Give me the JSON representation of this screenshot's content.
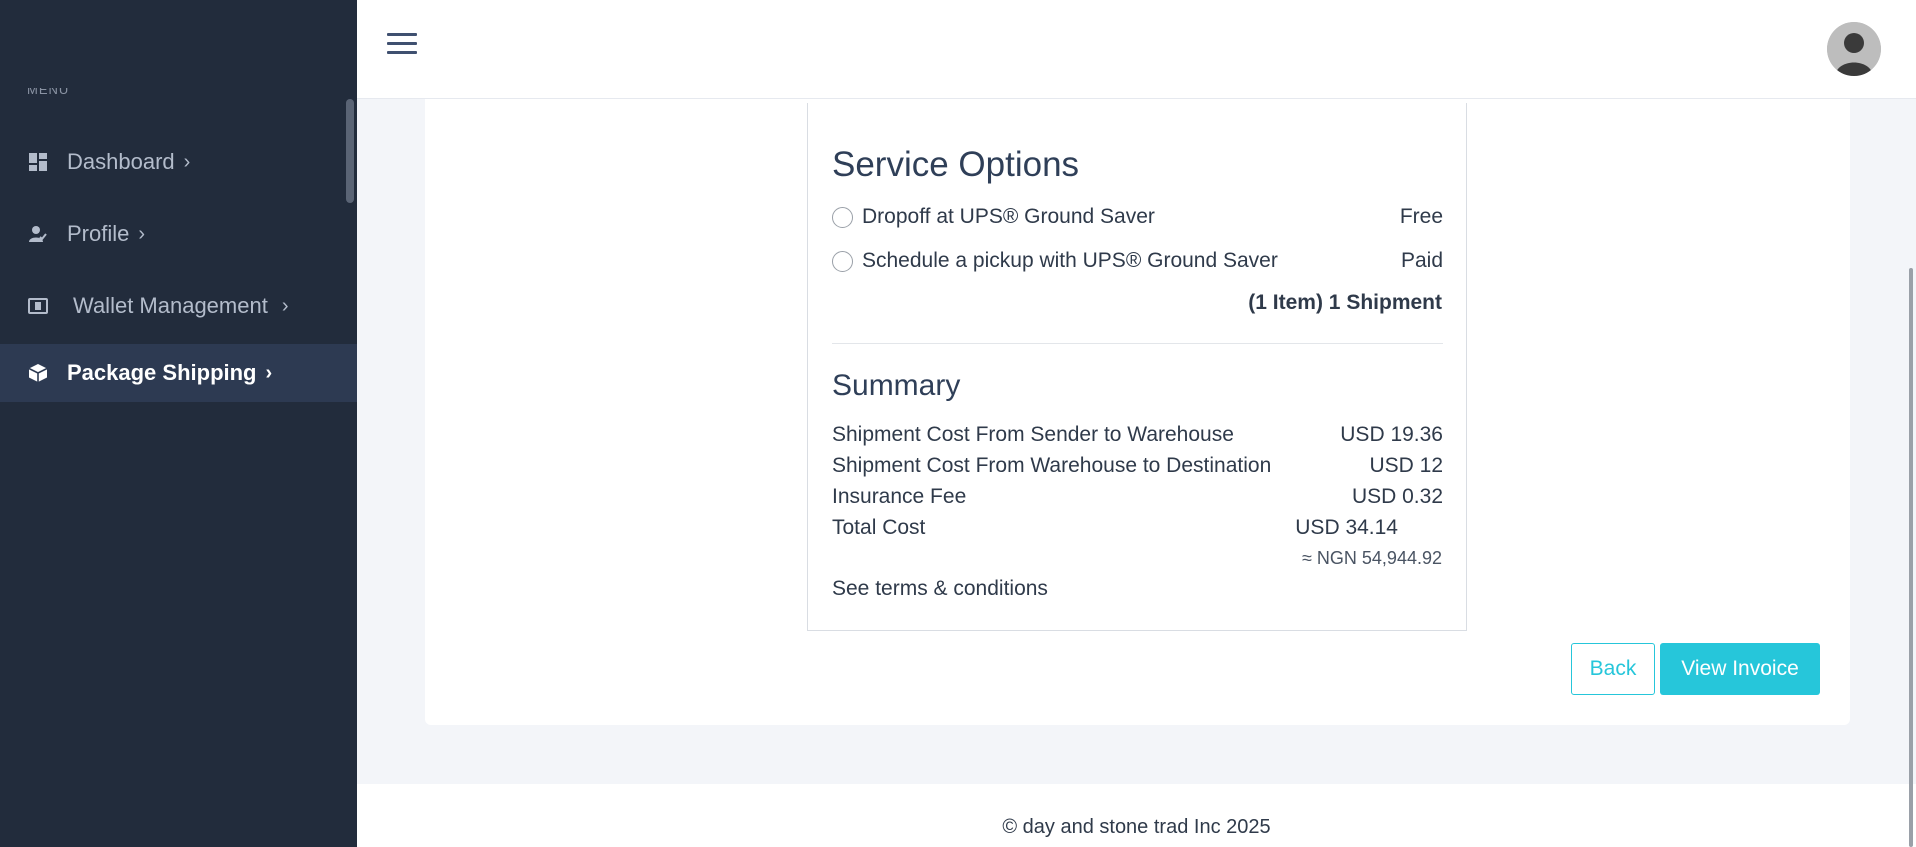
{
  "sidebar": {
    "menu_heading": "MENU",
    "items": [
      {
        "label": "Dashboard",
        "icon": "dashboard-icon"
      },
      {
        "label": "Profile",
        "icon": "profile-icon"
      },
      {
        "label": "Wallet Management",
        "icon": "wallet-icon"
      },
      {
        "label": "Package Shipping",
        "icon": "package-icon",
        "active": true
      }
    ],
    "chevron": "›"
  },
  "header": {
    "menu_icon": "hamburger-icon",
    "avatar_icon": "avatar-icon"
  },
  "service_options": {
    "title": "Service Options",
    "options": [
      {
        "label": "Dropoff at UPS® Ground Saver",
        "price": "Free"
      },
      {
        "label": "Schedule a pickup with UPS® Ground Saver",
        "price": "Paid"
      }
    ],
    "shipments": "(1 Item) 1 Shipment"
  },
  "summary": {
    "title": "Summary",
    "rows": [
      {
        "label": "Shipment Cost From Sender to Warehouse",
        "value": "USD 19.36"
      },
      {
        "label": "Shipment Cost From Warehouse to Destination",
        "value": "USD 12"
      },
      {
        "label": "Insurance Fee",
        "value": "USD 0.32"
      }
    ],
    "total_label": "Total Cost",
    "total_value": "USD 34.14",
    "ngn_value": "≈ NGN 54,944.92",
    "terms": "See terms & conditions"
  },
  "actions": {
    "back": "Back",
    "view_invoice": "View Invoice"
  },
  "footer": {
    "text": "© day and stone trad Inc 2025"
  },
  "colors": {
    "sidebar": "#222c3c",
    "accent": "#26c6da",
    "active_item": "#2d3a52"
  }
}
